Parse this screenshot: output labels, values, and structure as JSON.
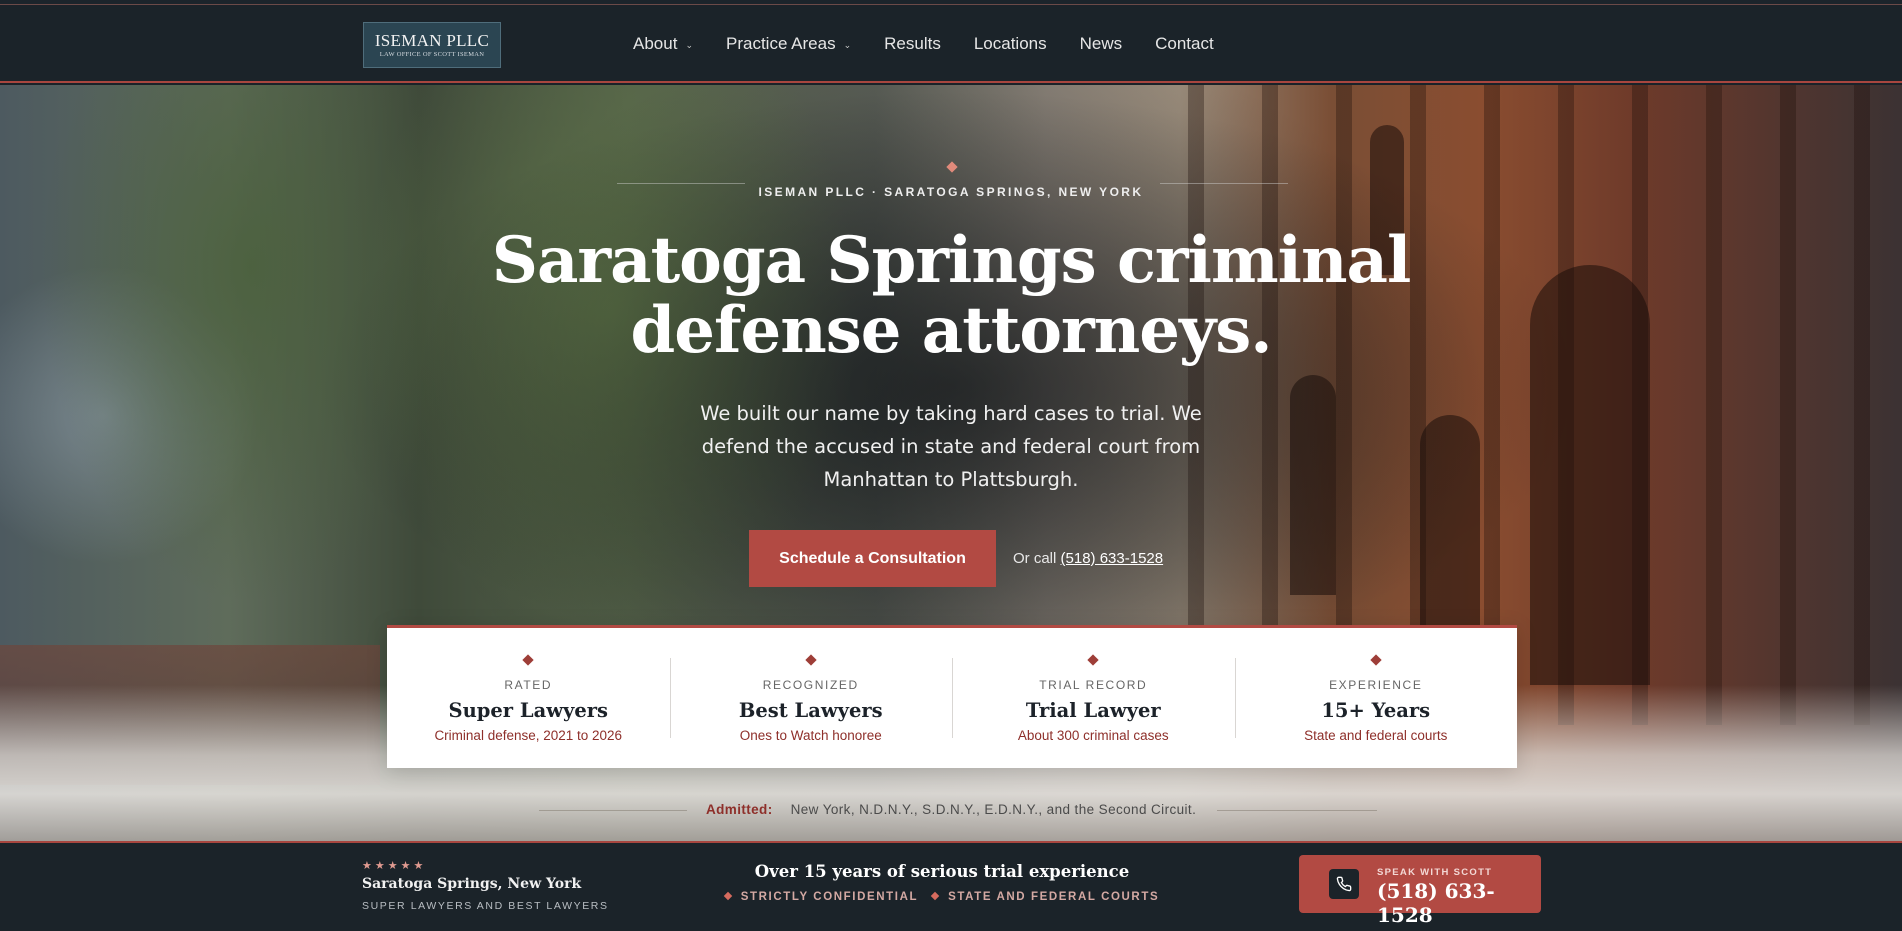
{
  "header": {
    "logo": {
      "name": "ISEMAN PLLC",
      "sub": "LAW OFFICE OF SCOTT ISEMAN"
    },
    "nav": [
      {
        "label": "About",
        "has_dropdown": true
      },
      {
        "label": "Practice Areas",
        "has_dropdown": true
      },
      {
        "label": "Results",
        "has_dropdown": false
      },
      {
        "label": "Locations",
        "has_dropdown": false
      },
      {
        "label": "News",
        "has_dropdown": false
      },
      {
        "label": "Contact",
        "has_dropdown": false
      }
    ]
  },
  "hero": {
    "eyebrow": "ISEMAN PLLC · SARATOGA SPRINGS, NEW YORK",
    "headline_line1": "Saratoga Springs criminal",
    "headline_line2": "defense attorneys.",
    "subcopy": "We built our name by taking hard cases to trial. We defend the accused in state and federal court from Manhattan to Plattsburgh.",
    "cta_label": "Schedule a Consultation",
    "or_call": "Or call",
    "phone": "(518) 633-1528"
  },
  "credentials": [
    {
      "label": "RATED",
      "title": "Super Lawyers",
      "sub": "Criminal defense, 2021 to 2026"
    },
    {
      "label": "RECOGNIZED",
      "title": "Best Lawyers",
      "sub": "Ones to Watch honoree"
    },
    {
      "label": "TRIAL RECORD",
      "title": "Trial Lawyer",
      "sub": "About 300 criminal cases"
    },
    {
      "label": "EXPERIENCE",
      "title": "15+ Years",
      "sub": "State and federal courts"
    }
  ],
  "admitted": {
    "label": "Admitted:",
    "text": "New York, N.D.N.Y., S.D.N.Y., E.D.N.Y., and the Second Circuit."
  },
  "bottombar": {
    "stars": "★★★★★",
    "city": "Saratoga Springs, New York",
    "tagline": "SUPER LAWYERS AND BEST LAWYERS",
    "headline": "Over 15 years of serious trial experience",
    "features": [
      "STRICTLY CONFIDENTIAL",
      "STATE AND FEDERAL COURTS"
    ],
    "call_kicker": "SPEAK WITH SCOTT",
    "call_number": "(518) 633-1528"
  },
  "colors": {
    "accent": "#b24a43",
    "dark": "#1b2329",
    "burgundy_text": "#8e2f2a"
  }
}
